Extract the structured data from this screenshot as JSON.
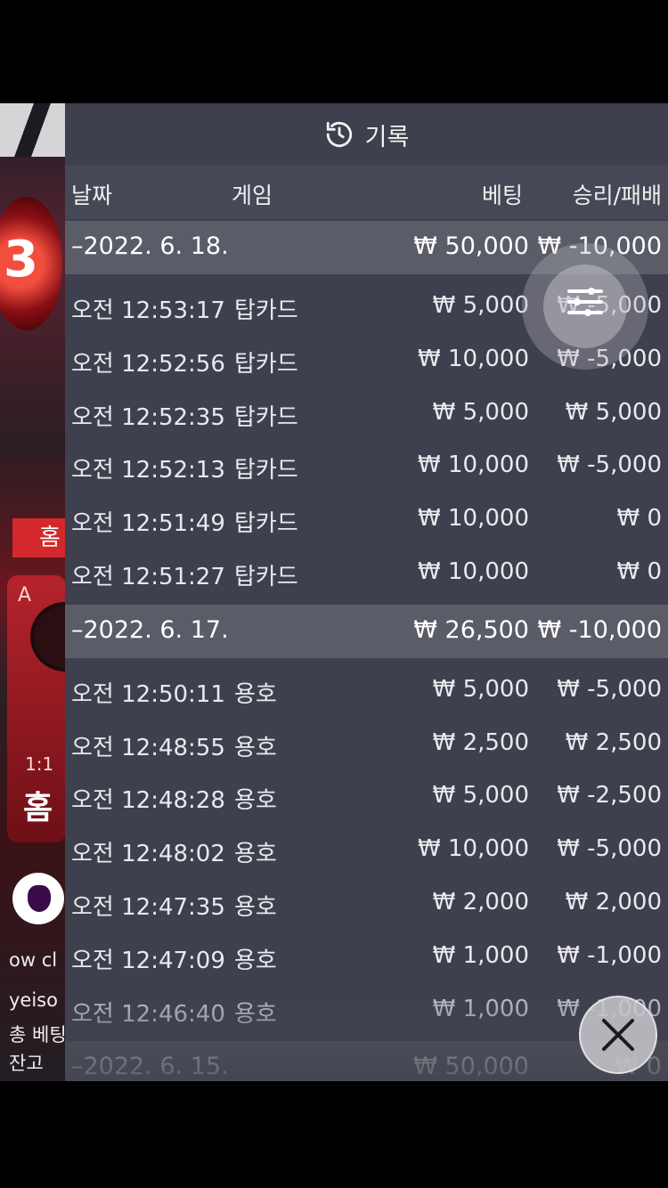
{
  "background": {
    "ball_number": "3",
    "home_tag": "홈",
    "card_label": "A",
    "card_ratio": "1:1",
    "card_home": "홈",
    "chat_line": "ow cl",
    "user_line": "yeiso",
    "total_bet_line": "총 베팅",
    "balance_line": "잔고"
  },
  "panel": {
    "title": "기록",
    "columns": {
      "date": "날짜",
      "game": "게임",
      "bet": "베팅",
      "result": "승리/패배"
    },
    "groups": [
      {
        "date": "–2022. 6. 18.",
        "total_bet": "₩ 50,000",
        "total_result": "₩ -10,000",
        "rows": [
          {
            "time": "오전 12:53:17",
            "game": "탑카드",
            "bet": "₩ 5,000",
            "result": "₩ -5,000"
          },
          {
            "time": "오전 12:52:56",
            "game": "탑카드",
            "bet": "₩ 10,000",
            "result": "₩ -5,000"
          },
          {
            "time": "오전 12:52:35",
            "game": "탑카드",
            "bet": "₩ 5,000",
            "result": "₩ 5,000"
          },
          {
            "time": "오전 12:52:13",
            "game": "탑카드",
            "bet": "₩ 10,000",
            "result": "₩ -5,000"
          },
          {
            "time": "오전 12:51:49",
            "game": "탑카드",
            "bet": "₩ 10,000",
            "result": "₩ 0"
          },
          {
            "time": "오전 12:51:27",
            "game": "탑카드",
            "bet": "₩ 10,000",
            "result": "₩ 0"
          }
        ]
      },
      {
        "date": "–2022. 6. 17.",
        "total_bet": "₩ 26,500",
        "total_result": "₩ -10,000",
        "rows": [
          {
            "time": "오전 12:50:11",
            "game": "용호",
            "bet": "₩ 5,000",
            "result": "₩ -5,000"
          },
          {
            "time": "오전 12:48:55",
            "game": "용호",
            "bet": "₩ 2,500",
            "result": "₩ 2,500"
          },
          {
            "time": "오전 12:48:28",
            "game": "용호",
            "bet": "₩ 5,000",
            "result": "₩ -2,500"
          },
          {
            "time": "오전 12:48:02",
            "game": "용호",
            "bet": "₩ 10,000",
            "result": "₩ -5,000"
          },
          {
            "time": "오전 12:47:35",
            "game": "용호",
            "bet": "₩ 2,000",
            "result": "₩ 2,000"
          },
          {
            "time": "오전 12:47:09",
            "game": "용호",
            "bet": "₩ 1,000",
            "result": "₩ -1,000"
          },
          {
            "time": "오전 12:46:40",
            "game": "용호",
            "bet": "₩ 1,000",
            "result": "₩ -1,000"
          }
        ]
      },
      {
        "date": "–2022. 6. 15.",
        "total_bet": "₩ 50,000",
        "total_result": "₩ 0",
        "rows": []
      }
    ]
  },
  "icons": {
    "history": "history-icon",
    "filter": "filter-icon",
    "close": "close-icon"
  },
  "colors": {
    "panel_bg": "#40424e",
    "date_row_bg": "#5a5c67",
    "header_bg": "#464856"
  }
}
